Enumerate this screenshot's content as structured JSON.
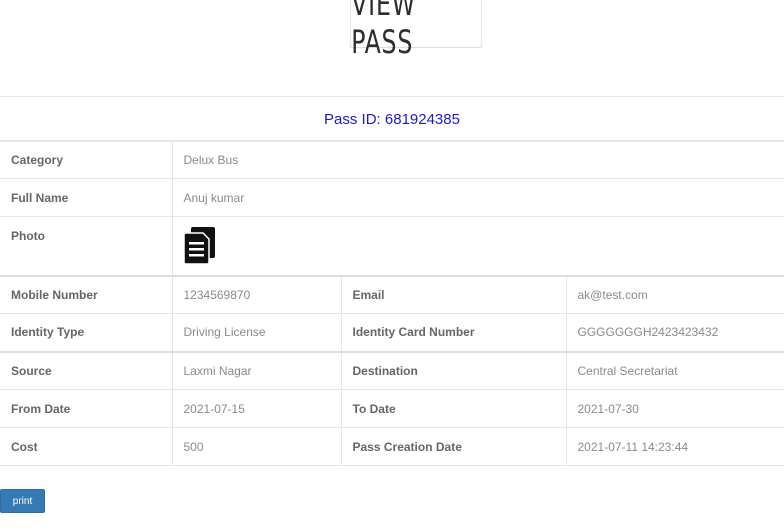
{
  "header": {
    "title": "VIEW PASS"
  },
  "pass": {
    "id_text": "Pass ID: 681924385"
  },
  "details": {
    "category": {
      "label": "Category",
      "value": "Delux Bus"
    },
    "full_name": {
      "label": "Full Name",
      "value": "Anuj kumar"
    },
    "photo": {
      "label": "Photo",
      "icon": "document-copy-icon"
    },
    "mobile": {
      "label": "Mobile Number",
      "value": "1234569870"
    },
    "email": {
      "label": "Email",
      "value": "ak@test.com"
    },
    "identity_type": {
      "label": "Identity Type",
      "value": "Driving License"
    },
    "identity_number": {
      "label": "Identity Card Number",
      "value": "GGGGGGGH2423423432"
    },
    "source": {
      "label": "Source",
      "value": "Laxmi Nagar"
    },
    "destination": {
      "label": "Destination",
      "value": "Central Secretariat"
    },
    "from_date": {
      "label": "From Date",
      "value": "2021-07-15"
    },
    "to_date": {
      "label": "To Date",
      "value": "2021-07-30"
    },
    "cost": {
      "label": "Cost",
      "value": "500"
    },
    "creation_date": {
      "label": "Pass Creation Date",
      "value": "2021-07-11 14:23:44"
    }
  },
  "actions": {
    "print_label": "print",
    "print_color": "#337ab7"
  }
}
